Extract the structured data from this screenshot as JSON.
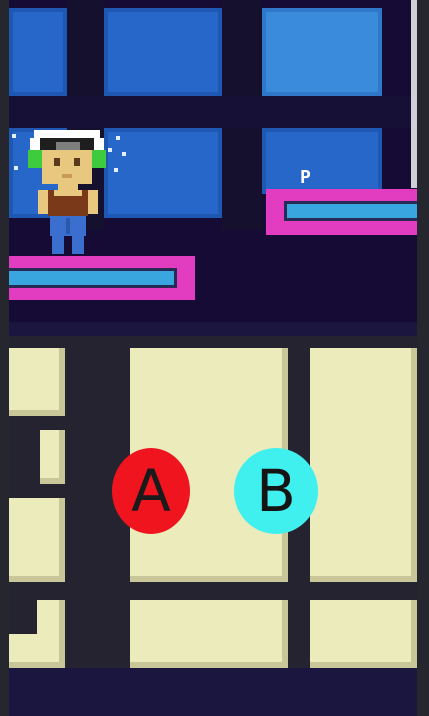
{
  "controls": {
    "a_label": "A",
    "b_label": "B"
  },
  "hud": {
    "platform_marker": "P"
  },
  "colors": {
    "background": "#160b34",
    "window_blue": "#2667c9",
    "platform_pink": "#e23cc0",
    "platform_bar": "#3aa6e0",
    "button_a": "#f0141e",
    "button_b": "#3ff0ee",
    "building_cream": "#ebebbb"
  },
  "icons": {
    "player": "player-character-icon",
    "sparkle": "sparkle-icon"
  }
}
